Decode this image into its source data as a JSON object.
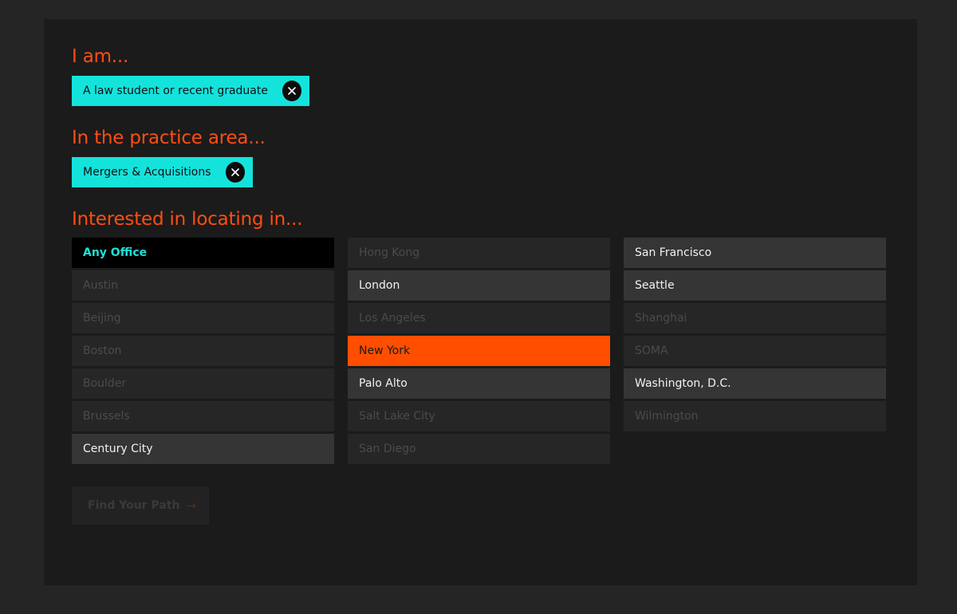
{
  "sections": {
    "role": {
      "heading": "I am...",
      "chip": "A law student or recent graduate"
    },
    "practice": {
      "heading": "In the practice area...",
      "chip": "Mergers & Acquisitions"
    },
    "location": {
      "heading": "Interested in locating in...",
      "columns": [
        [
          {
            "label": "Any Office",
            "state": "any"
          },
          {
            "label": "Austin",
            "state": "disabled"
          },
          {
            "label": "Beijing",
            "state": "disabled"
          },
          {
            "label": "Boston",
            "state": "disabled"
          },
          {
            "label": "Boulder",
            "state": "disabled"
          },
          {
            "label": "Brussels",
            "state": "disabled"
          },
          {
            "label": "Century City",
            "state": "enabled"
          }
        ],
        [
          {
            "label": "Hong Kong",
            "state": "disabled"
          },
          {
            "label": "London",
            "state": "enabled"
          },
          {
            "label": "Los Angeles",
            "state": "disabled"
          },
          {
            "label": "New York",
            "state": "selected"
          },
          {
            "label": "Palo Alto",
            "state": "enabled"
          },
          {
            "label": "Salt Lake City",
            "state": "disabled"
          },
          {
            "label": "San Diego",
            "state": "disabled"
          }
        ],
        [
          {
            "label": "San Francisco",
            "state": "enabled"
          },
          {
            "label": "Seattle",
            "state": "enabled"
          },
          {
            "label": "Shanghai",
            "state": "disabled"
          },
          {
            "label": "SOMA",
            "state": "disabled"
          },
          {
            "label": "Washington, D.C.",
            "state": "enabled"
          },
          {
            "label": "Wilmington",
            "state": "disabled"
          }
        ]
      ]
    }
  },
  "cta": {
    "label": "Find Your Path",
    "icon": "arrow-right-icon"
  },
  "colors": {
    "accent_orange": "#ff4e12",
    "chip_cyan": "#14e3dc",
    "selected_orange": "#ff4e00",
    "panel_bg": "#1b1b1b",
    "page_bg": "#252525"
  }
}
